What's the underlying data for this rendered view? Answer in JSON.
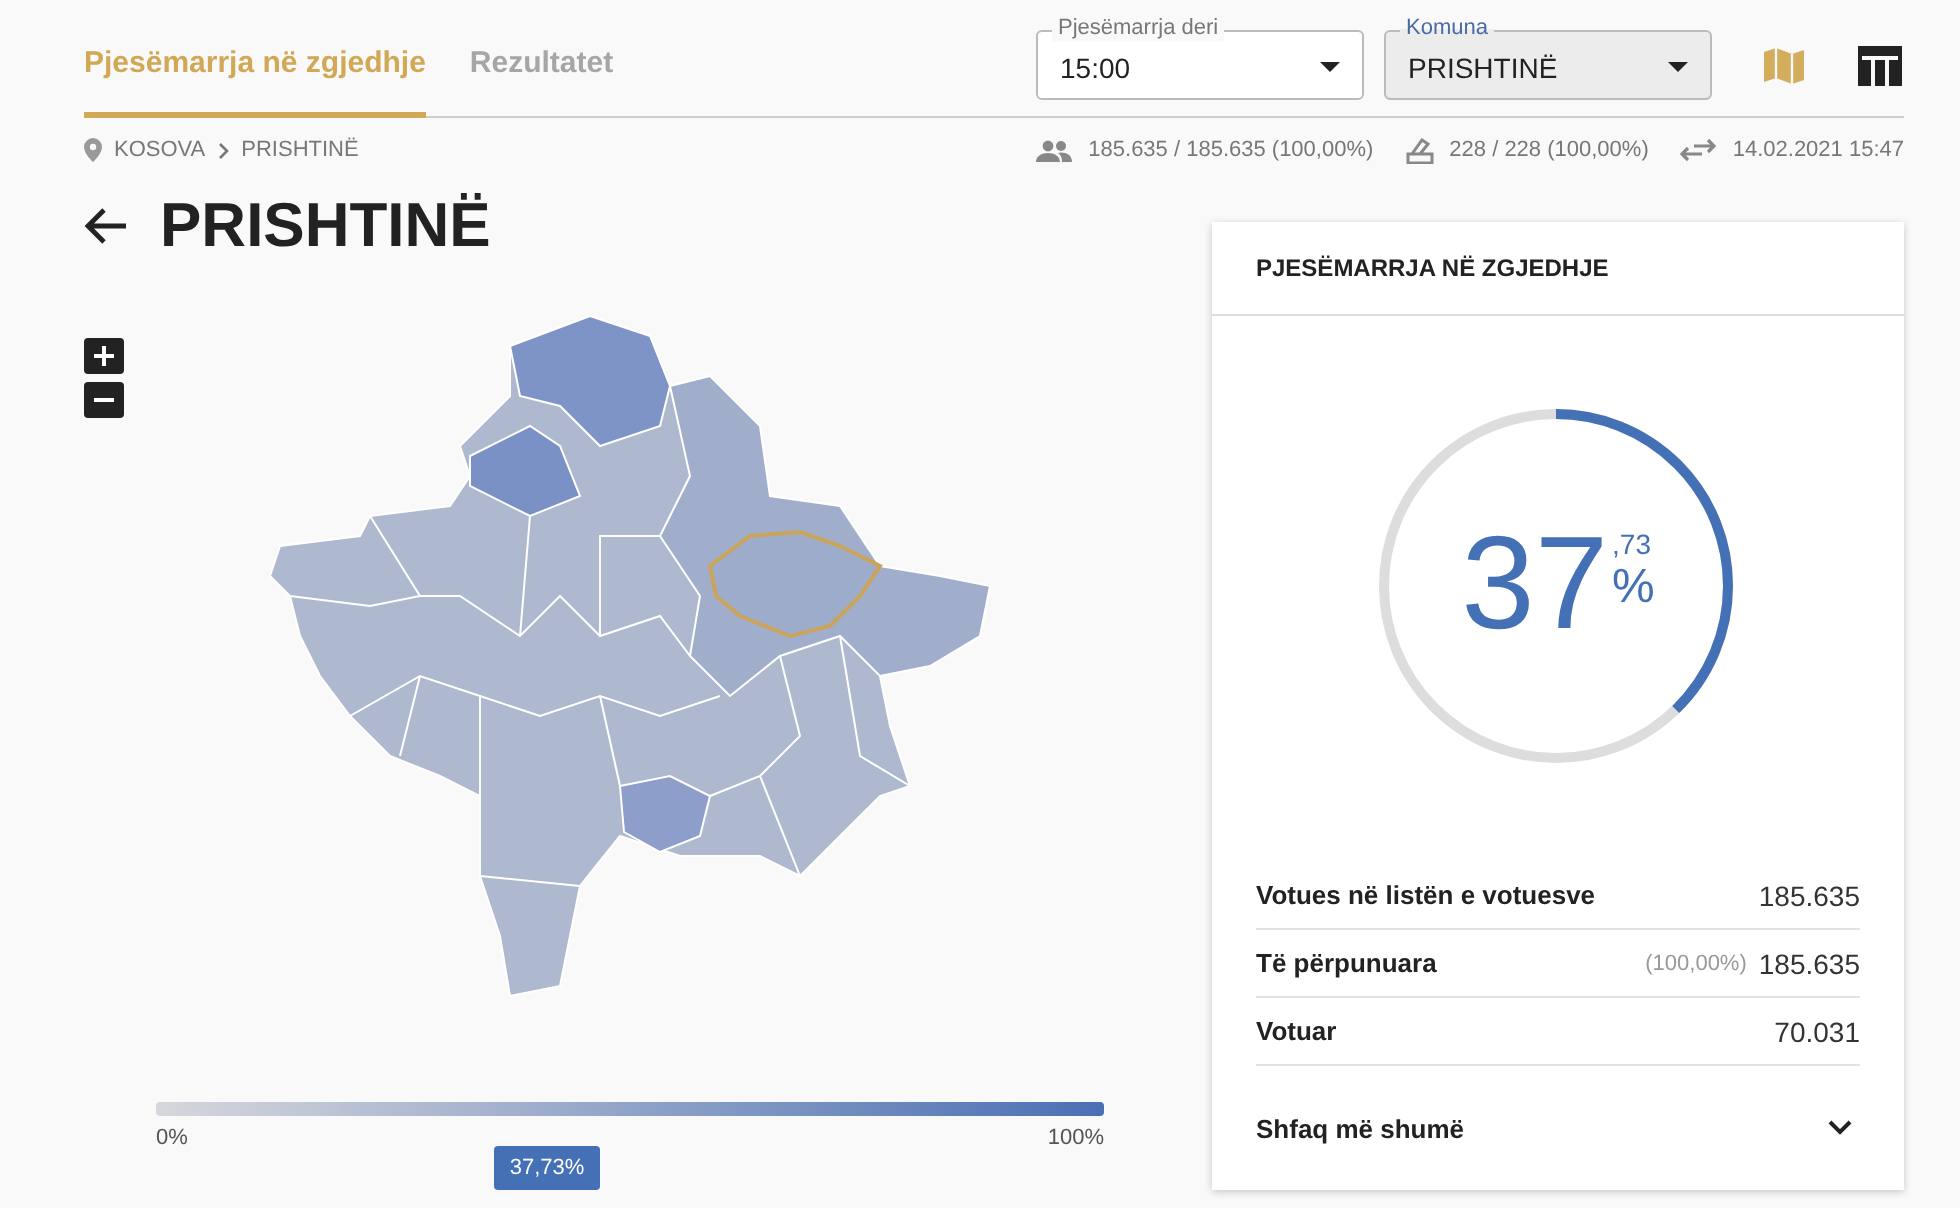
{
  "tabs": [
    {
      "label": "Pjesëmarrja në zgjedhje",
      "selected": true
    },
    {
      "label": "Rezultatet",
      "selected": false
    }
  ],
  "filters": [
    {
      "label": "Pjesëmarrja deri",
      "value": "15:00",
      "focused": false
    },
    {
      "label": "Komuna",
      "value": "PRISHTINË",
      "focused": true
    }
  ],
  "view_buttons": [
    {
      "kind": "map",
      "selected": true
    },
    {
      "kind": "table",
      "selected": false
    }
  ],
  "breadcrumb": [
    "KOSOVA",
    "PRISHTINË"
  ],
  "stats": [
    {
      "kind": "voters",
      "text": "185.635 / 185.635 (100,00%)"
    },
    {
      "kind": "stations",
      "text": "228 / 228 (100,00%)"
    },
    {
      "kind": "updated",
      "text": "14.02.2021 15:47"
    }
  ],
  "title": "PRISHTINË",
  "legend": {
    "min": "0%",
    "max": "100%",
    "level": 0.3773,
    "marker": "37,73%"
  },
  "card": {
    "title": "PJESËMARRJA NË ZGJEDHJE",
    "gauge": {
      "integer": "37",
      "decimal": ",73",
      "unit": "%"
    },
    "rows": [
      {
        "label": "Votues në listën e votuesve",
        "value": "185.635"
      },
      {
        "label": "Të përpunuara",
        "share": "(100,00%)",
        "value": "185.635"
      },
      {
        "label": "Votuar",
        "value": "70.031"
      }
    ],
    "more": "Shfaq më shumë"
  }
}
